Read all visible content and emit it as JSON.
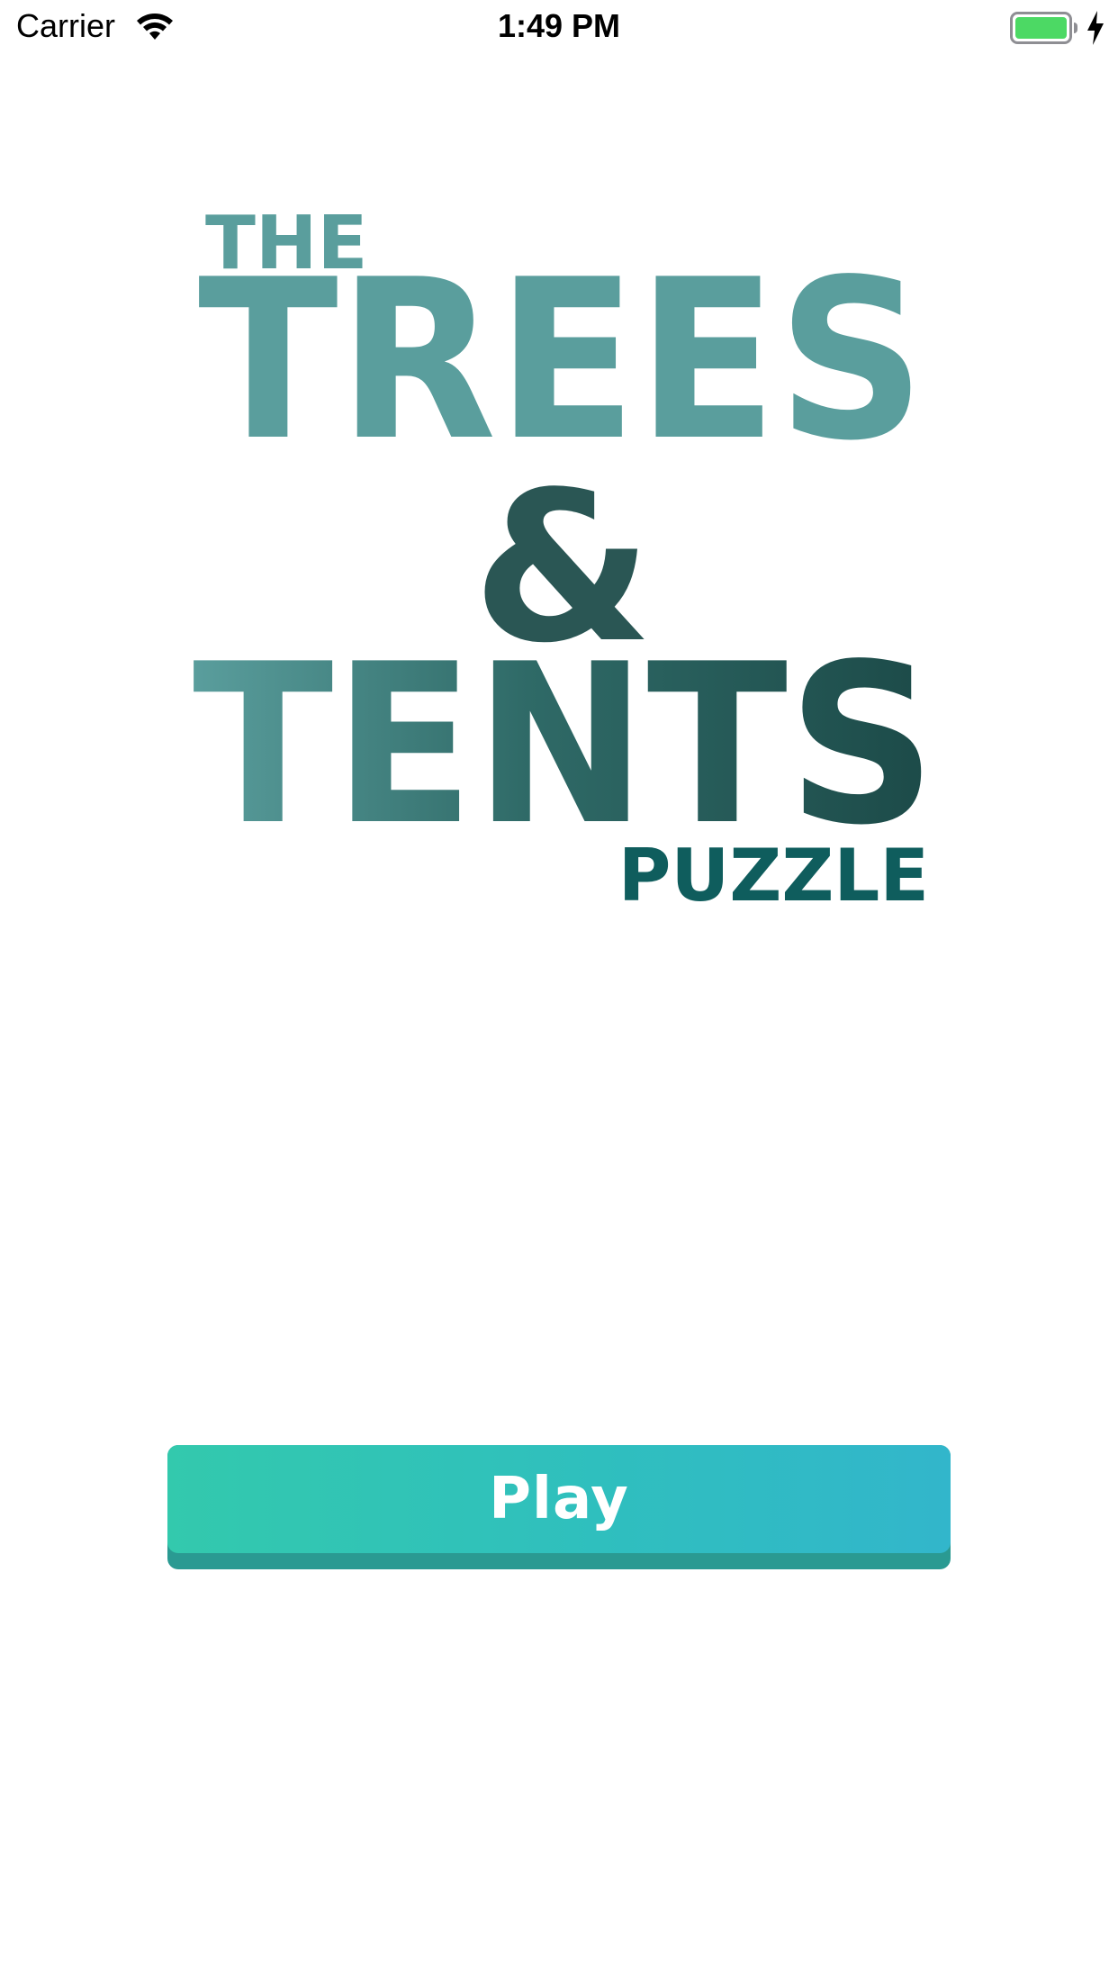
{
  "status_bar": {
    "carrier": "Carrier",
    "time": "1:49 PM",
    "battery_color": "#4cd964",
    "icons": [
      "wifi-icon",
      "battery-icon",
      "charging-icon"
    ]
  },
  "logo": {
    "line1": "THE",
    "line2": "TREES",
    "line3": "&",
    "line4": "TENTS",
    "line5": "PUZZLE",
    "colors": {
      "light": "#5a9e9d",
      "dark": "#1c4a48",
      "teal": "#0f5d5d"
    }
  },
  "play_button": {
    "label": "Play",
    "gradient_start": "#33c9ad",
    "gradient_end": "#32b6cb",
    "shadow_color": "#2a9a92"
  }
}
